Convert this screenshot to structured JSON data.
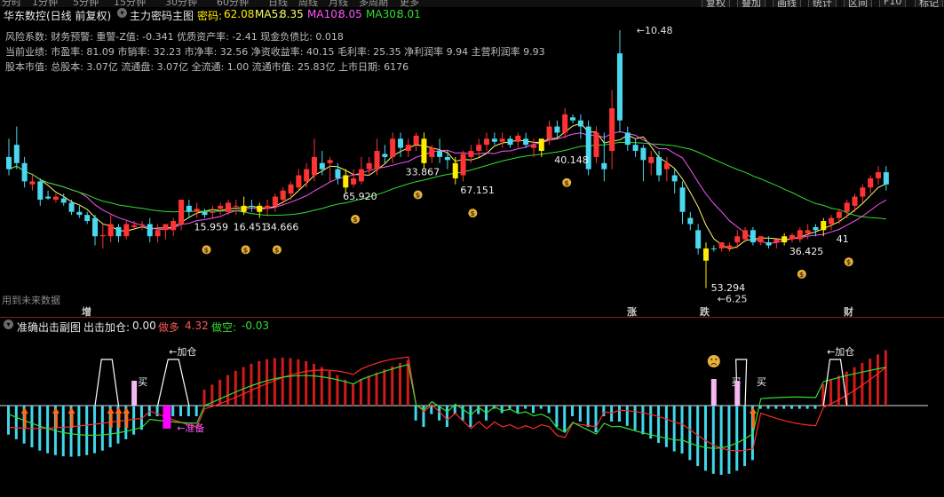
{
  "toolbar": {
    "tabs": [
      "分时",
      "1分钟",
      "5分钟",
      "15分钟",
      "30分钟",
      "60分钟",
      "日线",
      "周线",
      "月线",
      "多周期",
      "更多"
    ],
    "buttons": [
      "复权",
      "叠加",
      "画线",
      "统计",
      "区间",
      "F10",
      "标记"
    ]
  },
  "main_chart": {
    "title": "华东数控(日线 前复权)",
    "indicator_name": "主力密码主图",
    "password_label": "密码:",
    "password_value": "62.08",
    "ma5_label": "MA5:",
    "ma5_value": "8.35",
    "ma10_label": "MA10:",
    "ma10_value": "8.05",
    "ma30_label": "MA30:",
    "ma30_value": "8.01",
    "info_line1": "风险系数: 财务预警: 重警-Z值: -0.341 优质资产率: -2.41 现金负债比: 0.018",
    "info_line2": "当前业绩: 市盈率: 81.09 市销率: 32.23 市净率: 32.56 净资收益率: 40.15 毛利率: 25.35 净利润率 9.94 主营利润率 9.93",
    "info_line3": "股本市值: 总股本: 3.07亿 流通盘: 3.07亿 全流通: 1.00 流通市值: 25.83亿 上市日期: 6176",
    "future_data_note": "用到未来数据",
    "high_label": "10.48",
    "low_label": "6.25",
    "value_labels": [
      "15.959",
      "16.451",
      "34.666",
      "65.920",
      "33.867",
      "67.151",
      "40.148",
      "53.294",
      "36.425",
      "41"
    ],
    "markers": [
      {
        "text": "增",
        "color": "#ff3b3b"
      },
      {
        "text": "涨",
        "color": "#ff3b3b"
      },
      {
        "text": "跌",
        "color": "#2ecc40"
      },
      {
        "text": "财",
        "color": "#3aa0ff"
      }
    ],
    "colors": {
      "up": "#ff3333",
      "down": "#4ad8ef",
      "highlight": "#ffee00",
      "ma5": "#ffff66",
      "ma10": "#ff55ff",
      "ma30": "#33dd33",
      "background": "#000000"
    }
  },
  "sub_chart": {
    "indicator_name": "准确出击副图",
    "signal_label": "出击加仓:",
    "signal_value": "0.00",
    "bull_label": "做多",
    "bull_value": "4.32",
    "bear_label": "做空:",
    "bear_value": "-0.03",
    "annotations": {
      "add_position": "←加仓",
      "buy": "买",
      "prepare": "←准备"
    },
    "icons": [
      "sad-face-icon",
      "up-arrow-icon",
      "money-bag-icon"
    ]
  }
}
